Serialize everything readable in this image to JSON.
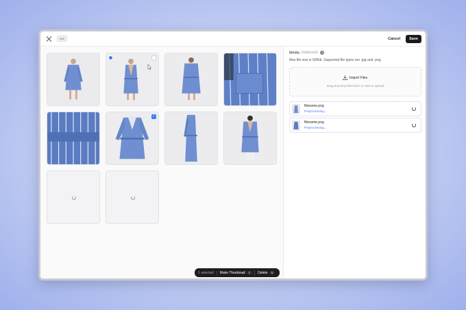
{
  "topbar": {
    "esc_label": "esc",
    "cancel_label": "Cancel",
    "save_label": "Save"
  },
  "gallery": {
    "tiles": [
      {
        "kind": "robe-front",
        "thumbnail": false,
        "checkbox": "none"
      },
      {
        "kind": "robe-front",
        "thumbnail": true,
        "checkbox": "empty"
      },
      {
        "kind": "robe-back",
        "thumbnail": false,
        "checkbox": "none"
      },
      {
        "kind": "fabric-pocket",
        "thumbnail": false,
        "checkbox": "none"
      },
      {
        "kind": "fabric-stripes",
        "thumbnail": false,
        "checkbox": "none"
      },
      {
        "kind": "robe-flat",
        "thumbnail": false,
        "checkbox": "checked"
      },
      {
        "kind": "robe-side",
        "thumbnail": false,
        "checkbox": "none"
      },
      {
        "kind": "robe-model",
        "thumbnail": false,
        "checkbox": "none"
      },
      {
        "kind": "loading",
        "thumbnail": false,
        "checkbox": "none"
      },
      {
        "kind": "loading",
        "thumbnail": false,
        "checkbox": "none"
      }
    ]
  },
  "actionbar": {
    "selected_label": "1 selected",
    "thumbnail_label": "Make Thumbnail",
    "thumbnail_key": "T",
    "delete_label": "Delete",
    "delete_key": "D"
  },
  "media": {
    "title": "Media",
    "optional": "(Optional)",
    "description": "Max file size is 500kb. Supported file types are .jpg and .png.",
    "import_label": "Import Files",
    "drop_hint": "Drag and drop files here or click to upload",
    "files": [
      {
        "name": "filename.png",
        "status": "Preprocessing..."
      },
      {
        "name": "filename.png",
        "status": "Preprocessing..."
      }
    ]
  },
  "colors": {
    "robe": "#6f8fd0",
    "accent": "#3b7bf6",
    "dark": "#1e1e20"
  }
}
